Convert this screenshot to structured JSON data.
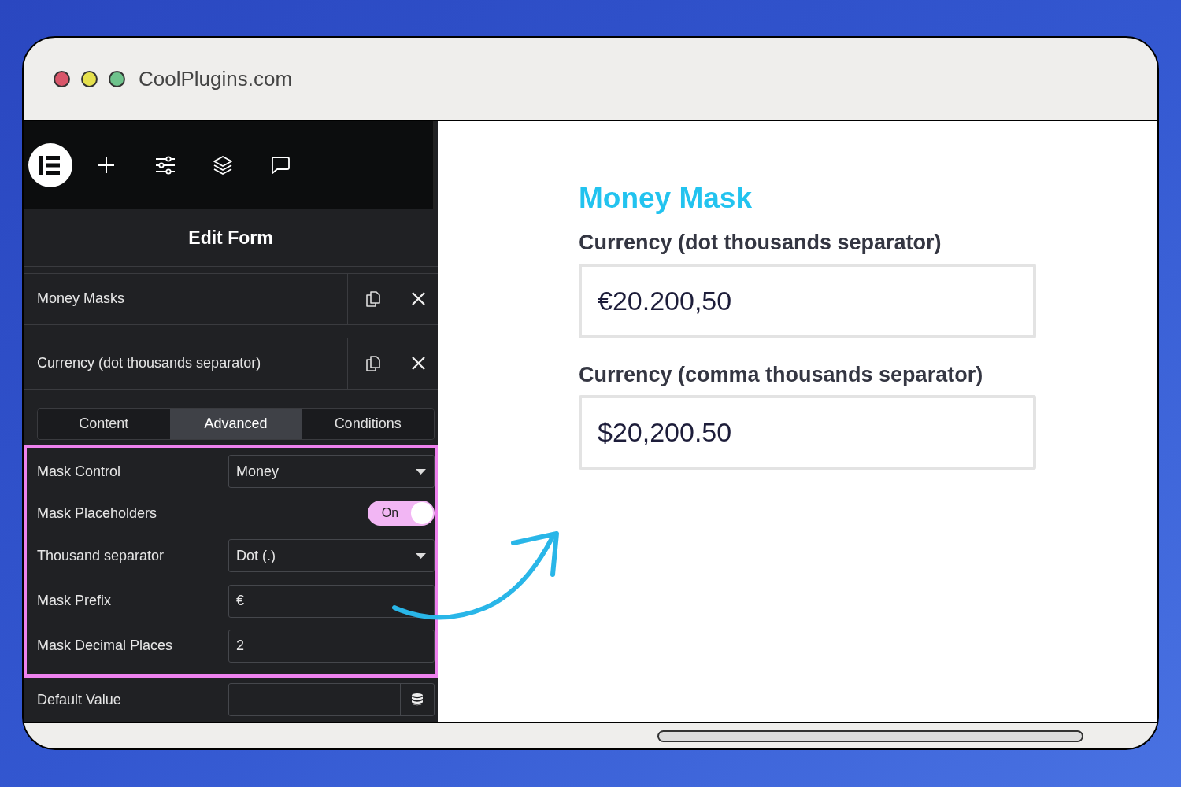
{
  "browser": {
    "title": "CoolPlugins.com"
  },
  "panel": {
    "title": "Edit Form",
    "repeater_items": [
      {
        "label": "Money Masks"
      },
      {
        "label": "Currency (dot thousands separator)"
      }
    ],
    "tabs": [
      {
        "label": "Content",
        "selected": false
      },
      {
        "label": "Advanced",
        "selected": true
      },
      {
        "label": "Conditions",
        "selected": false
      }
    ],
    "highlighted_controls": [
      {
        "kind": "select",
        "label": "Mask Control",
        "value": "Money"
      },
      {
        "kind": "toggle",
        "label": "Mask Placeholders",
        "on": true,
        "text": "On"
      },
      {
        "kind": "select",
        "label": "Thousand separator",
        "value": "Dot (.)"
      },
      {
        "kind": "input",
        "label": "Mask Prefix",
        "value": "€"
      },
      {
        "kind": "input",
        "label": "Mask Decimal Places",
        "value": "2"
      }
    ],
    "other_controls": [
      {
        "kind": "dynamic",
        "label": "Default Value"
      }
    ]
  },
  "preview": {
    "heading": "Money Mask",
    "fields": [
      {
        "label": "Currency (dot thousands separator)",
        "value": "€20.200,50"
      },
      {
        "label": "Currency (comma thousands separator)",
        "value": "$20,200.50"
      }
    ]
  }
}
